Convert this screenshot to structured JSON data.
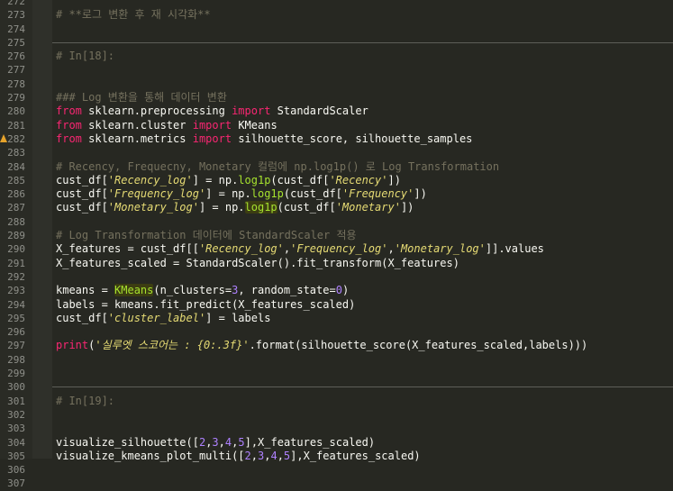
{
  "colors": {
    "background": "#272822",
    "gutter": "#2a2b25",
    "line_number": "#8f908a",
    "comment": "#75715e",
    "keyword": "#f92672",
    "string": "#e6db74",
    "number": "#ae81ff",
    "function": "#a6e22e",
    "default": "#f8f8f2",
    "warning": "#e6a32b"
  },
  "icons": {
    "warning_marker": "warning-triangle-icon"
  },
  "lines": [
    {
      "num": "272",
      "tokens": []
    },
    {
      "num": "273",
      "tokens": [
        {
          "t": "# **로그 변환 후 재 시각화**",
          "c": "cm"
        }
      ]
    },
    {
      "num": "274",
      "tokens": []
    },
    {
      "num": "275",
      "sep": true,
      "tokens": []
    },
    {
      "num": "276",
      "tokens": [
        {
          "t": "# In[18]:",
          "c": "cm"
        }
      ]
    },
    {
      "num": "277",
      "tokens": []
    },
    {
      "num": "278",
      "tokens": []
    },
    {
      "num": "279",
      "tokens": [
        {
          "t": "### Log 변환을 통해 데이터 변환",
          "c": "cm"
        }
      ]
    },
    {
      "num": "280",
      "tokens": [
        {
          "t": "from",
          "c": "kw"
        },
        {
          "t": " sklearn.preprocessing ",
          "c": "def"
        },
        {
          "t": "import",
          "c": "kw"
        },
        {
          "t": " StandardScaler",
          "c": "def"
        }
      ]
    },
    {
      "num": "281",
      "tokens": [
        {
          "t": "from",
          "c": "kw"
        },
        {
          "t": " sklearn.cluster ",
          "c": "def"
        },
        {
          "t": "import",
          "c": "kw"
        },
        {
          "t": " KMeans",
          "c": "def"
        }
      ]
    },
    {
      "num": "282",
      "warn": true,
      "tokens": [
        {
          "t": "from",
          "c": "kw"
        },
        {
          "t": " sklearn.metrics ",
          "c": "def"
        },
        {
          "t": "import",
          "c": "kw"
        },
        {
          "t": " silhouette_score, silhouette_samples",
          "c": "def"
        }
      ]
    },
    {
      "num": "283",
      "tokens": []
    },
    {
      "num": "284",
      "tokens": [
        {
          "t": "# Recency, Frequecny, Monetary 컬럼에 np.log1p() 로 Log Transformation",
          "c": "cm"
        }
      ]
    },
    {
      "num": "285",
      "tokens": [
        {
          "t": "cust_df[",
          "c": "def"
        },
        {
          "t": "'Recency_log'",
          "c": "str"
        },
        {
          "t": "] = np.",
          "c": "def"
        },
        {
          "t": "log1p",
          "c": "call"
        },
        {
          "t": "(cust_df[",
          "c": "def"
        },
        {
          "t": "'Recency'",
          "c": "str"
        },
        {
          "t": "])",
          "c": "def"
        }
      ]
    },
    {
      "num": "286",
      "tokens": [
        {
          "t": "cust_df[",
          "c": "def"
        },
        {
          "t": "'Frequency_log'",
          "c": "str"
        },
        {
          "t": "] = np.",
          "c": "def"
        },
        {
          "t": "log1p",
          "c": "call"
        },
        {
          "t": "(cust_df[",
          "c": "def"
        },
        {
          "t": "'Frequency'",
          "c": "str"
        },
        {
          "t": "])",
          "c": "def"
        }
      ]
    },
    {
      "num": "287",
      "tokens": [
        {
          "t": "cust_df[",
          "c": "def"
        },
        {
          "t": "'Monetary_log'",
          "c": "str"
        },
        {
          "t": "] = np.",
          "c": "def"
        },
        {
          "t": "log1p",
          "c": "call",
          "hl": true
        },
        {
          "t": "(cust_df[",
          "c": "def"
        },
        {
          "t": "'Monetary'",
          "c": "str"
        },
        {
          "t": "])",
          "c": "def"
        }
      ]
    },
    {
      "num": "288",
      "tokens": []
    },
    {
      "num": "289",
      "tokens": [
        {
          "t": "# Log Transformation 데이터에 StandardScaler 적용",
          "c": "cm"
        }
      ]
    },
    {
      "num": "290",
      "tokens": [
        {
          "t": "X_features = cust_df[[",
          "c": "def"
        },
        {
          "t": "'Recency_log'",
          "c": "str"
        },
        {
          "t": ",",
          "c": "def"
        },
        {
          "t": "'Frequency_log'",
          "c": "str"
        },
        {
          "t": ",",
          "c": "def"
        },
        {
          "t": "'Monetary_log'",
          "c": "str"
        },
        {
          "t": "]].values",
          "c": "def"
        }
      ]
    },
    {
      "num": "291",
      "tokens": [
        {
          "t": "X_features_scaled = StandardScaler().fit_transform(X_features)",
          "c": "def"
        }
      ]
    },
    {
      "num": "292",
      "tokens": []
    },
    {
      "num": "293",
      "tokens": [
        {
          "t": "kmeans = ",
          "c": "def"
        },
        {
          "t": "KMeans",
          "c": "call",
          "hl": true
        },
        {
          "t": "(n_clusters=",
          "c": "def"
        },
        {
          "t": "3",
          "c": "num"
        },
        {
          "t": ", random_state=",
          "c": "def"
        },
        {
          "t": "0",
          "c": "num"
        },
        {
          "t": ")",
          "c": "def"
        }
      ]
    },
    {
      "num": "294",
      "tokens": [
        {
          "t": "labels = kmeans.fit_predict(X_features_scaled)",
          "c": "def"
        }
      ]
    },
    {
      "num": "295",
      "tokens": [
        {
          "t": "cust_df[",
          "c": "def"
        },
        {
          "t": "'cluster_label'",
          "c": "str"
        },
        {
          "t": "] = labels",
          "c": "def"
        }
      ]
    },
    {
      "num": "296",
      "tokens": []
    },
    {
      "num": "297",
      "tokens": [
        {
          "t": "print",
          "c": "kw"
        },
        {
          "t": "(",
          "c": "def"
        },
        {
          "t": "'실루엣 스코어는 : {0:.3f}'",
          "c": "str"
        },
        {
          "t": ".format(silhouette_score(X_features_scaled,labels)))",
          "c": "def"
        }
      ]
    },
    {
      "num": "298",
      "tokens": []
    },
    {
      "num": "299",
      "tokens": []
    },
    {
      "num": "300",
      "sep": true,
      "tokens": []
    },
    {
      "num": "301",
      "tokens": [
        {
          "t": "# In[19]:",
          "c": "cm"
        }
      ]
    },
    {
      "num": "302",
      "tokens": []
    },
    {
      "num": "303",
      "tokens": []
    },
    {
      "num": "304",
      "tokens": [
        {
          "t": "visualize_silhouette([",
          "c": "def"
        },
        {
          "t": "2",
          "c": "num"
        },
        {
          "t": ",",
          "c": "def"
        },
        {
          "t": "3",
          "c": "num"
        },
        {
          "t": ",",
          "c": "def"
        },
        {
          "t": "4",
          "c": "num"
        },
        {
          "t": ",",
          "c": "def"
        },
        {
          "t": "5",
          "c": "num"
        },
        {
          "t": "],X_features_scaled)",
          "c": "def"
        }
      ]
    },
    {
      "num": "305",
      "tokens": [
        {
          "t": "visualize_kmeans_plot_multi([",
          "c": "def"
        },
        {
          "t": "2",
          "c": "num"
        },
        {
          "t": ",",
          "c": "def"
        },
        {
          "t": "3",
          "c": "num"
        },
        {
          "t": ",",
          "c": "def"
        },
        {
          "t": "4",
          "c": "num"
        },
        {
          "t": ",",
          "c": "def"
        },
        {
          "t": "5",
          "c": "num"
        },
        {
          "t": "],X_features_scaled)",
          "c": "def"
        }
      ]
    },
    {
      "num": "306",
      "tokens": []
    },
    {
      "num": "307",
      "tokens": []
    }
  ]
}
